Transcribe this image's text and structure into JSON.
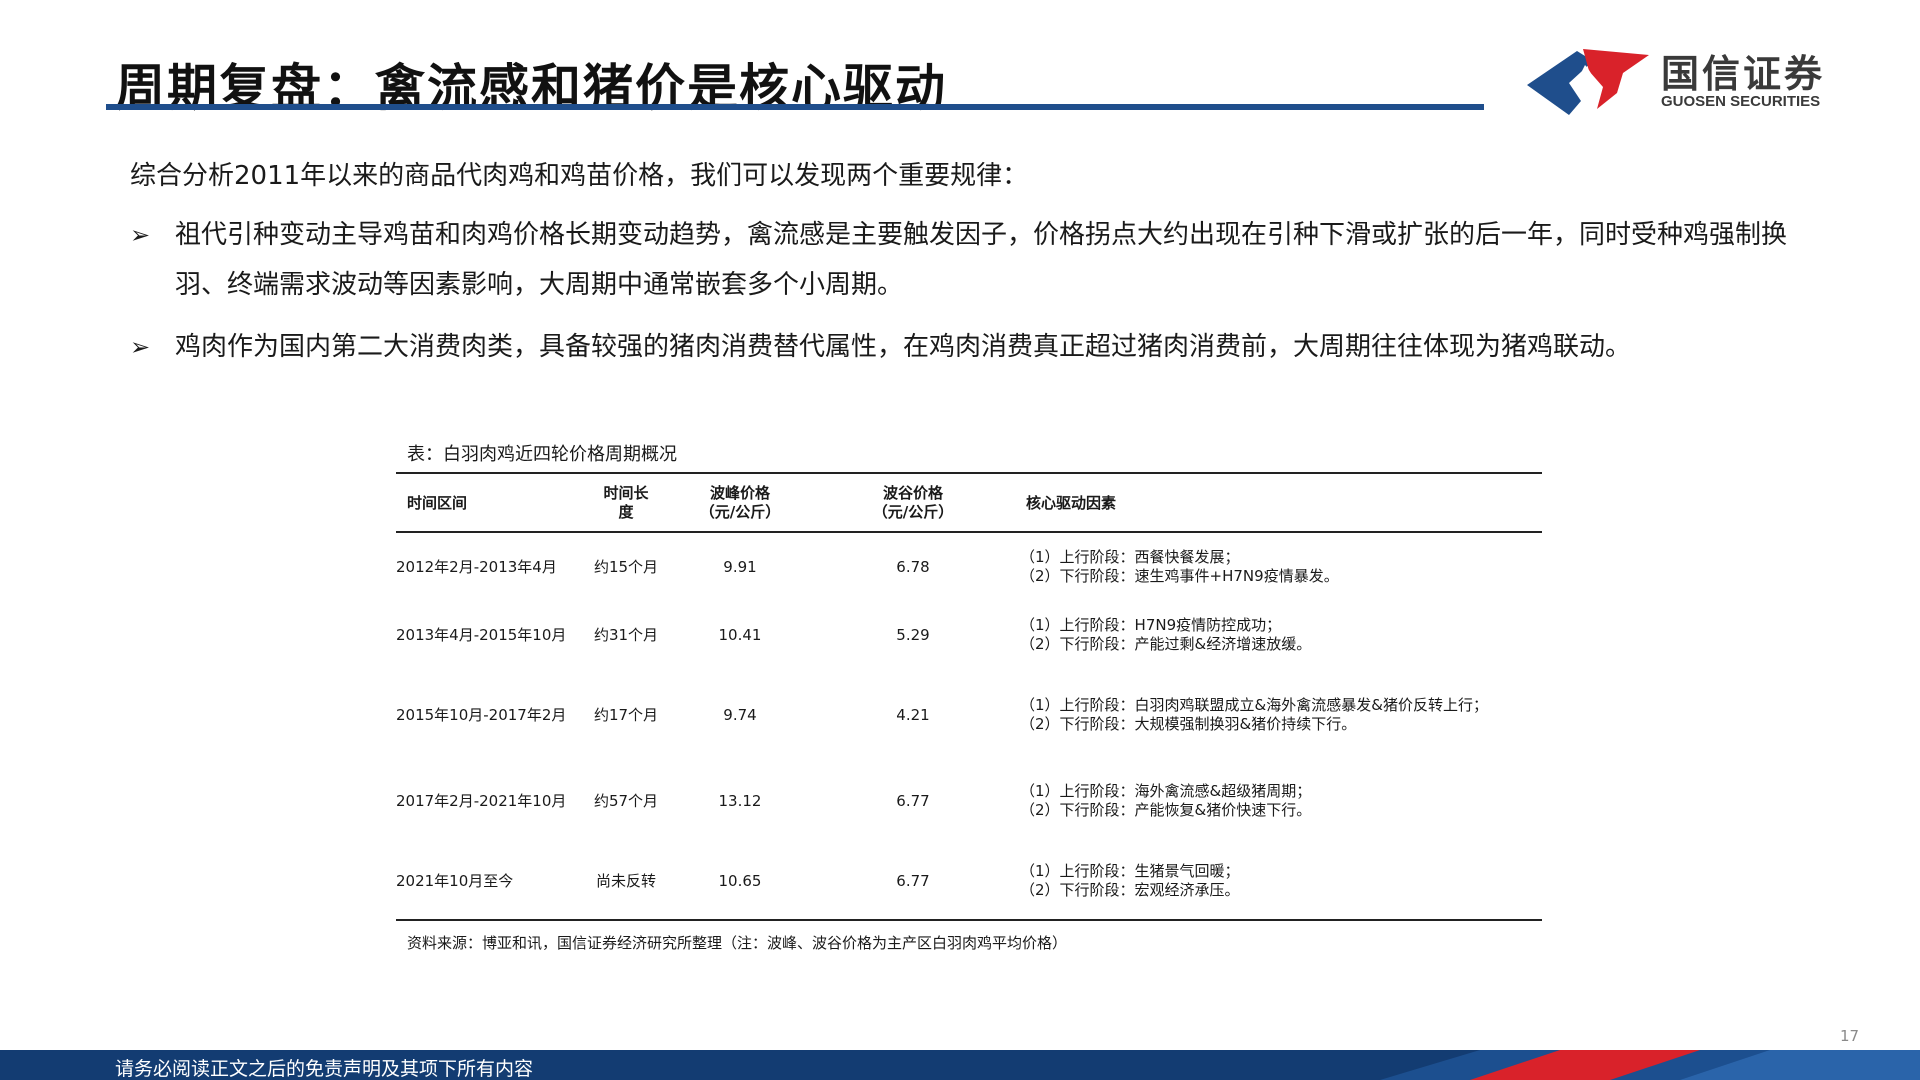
{
  "header": {
    "title": "周期复盘：禽流感和猪价是核心驱动",
    "logo_cn": "国信证券",
    "logo_en": "GUOSEN SECURITIES"
  },
  "intro": "综合分析2011年以来的商品代肉鸡和鸡苗价格，我们可以发现两个重要规律：",
  "bullets": [
    "祖代引种变动主导鸡苗和肉鸡价格长期变动趋势，禽流感是主要触发因子，价格拐点大约出现在引种下滑或扩张的后一年，同时受种鸡强制换羽、终端需求波动等因素影响，大周期中通常嵌套多个小周期。",
    "鸡肉作为国内第二大消费肉类，具备较强的猪肉消费替代属性，在鸡肉消费真正超过猪肉消费前，大周期往往体现为猪鸡联动。"
  ],
  "table": {
    "caption": "表：白羽肉鸡近四轮价格周期概况",
    "headers": {
      "period": "时间区间",
      "duration_l1": "时间长",
      "duration_l2": "度",
      "peak_l1": "波峰价格",
      "peak_l2": "（元/公斤）",
      "trough_l1": "波谷价格",
      "trough_l2": "（元/公斤）",
      "drivers": "核心驱动因素"
    },
    "rows": [
      {
        "period": "2012年2月-2013年4月",
        "duration": "约15个月",
        "peak": "9.91",
        "trough": "6.78",
        "driver_up": "（1）上行阶段：西餐快餐发展；",
        "driver_down": "（2）下行阶段：速生鸡事件+H7N9疫情暴发。"
      },
      {
        "period": "2013年4月-2015年10月",
        "duration": "约31个月",
        "peak": "10.41",
        "trough": "5.29",
        "driver_up": "（1）上行阶段：H7N9疫情防控成功；",
        "driver_down": "（2）下行阶段：产能过剩&经济增速放缓。"
      },
      {
        "period": "2015年10月-2017年2月",
        "duration": "约17个月",
        "peak": "9.74",
        "trough": "4.21",
        "driver_up": "（1）上行阶段：白羽肉鸡联盟成立&海外禽流感暴发&猪价反转上行；",
        "driver_down": "（2）下行阶段：大规模强制换羽&猪价持续下行。"
      },
      {
        "period": "2017年2月-2021年10月",
        "duration": "约57个月",
        "peak": "13.12",
        "trough": "6.77",
        "driver_up": "（1）上行阶段：海外禽流感&超级猪周期；",
        "driver_down": "（2）下行阶段：产能恢复&猪价快速下行。"
      },
      {
        "period": "2021年10月至今",
        "duration": "尚未反转",
        "peak": "10.65",
        "trough": "6.77",
        "driver_up": "（1）上行阶段：生猪景气回暖；",
        "driver_down": "（2）下行阶段：宏观经济承压。"
      }
    ],
    "source": "资料来源：博亚和讯，国信证券经济研究所整理（注：波峰、波谷价格为主产区白羽肉鸡平均价格）"
  },
  "page_number": "17",
  "footer": "请务必阅读正文之后的免责声明及其项下所有内容",
  "colors": {
    "brand_blue": "#1f4e8c",
    "brand_red": "#d9222a",
    "footer_bg": "#133c72"
  }
}
